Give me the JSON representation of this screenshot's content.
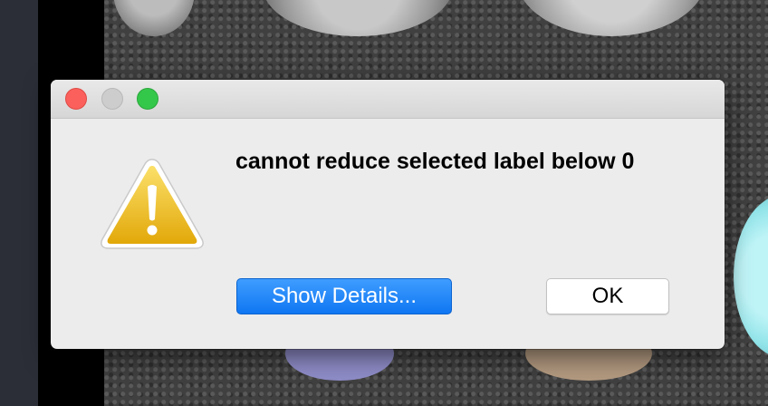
{
  "dialog": {
    "message": "cannot reduce selected label below 0",
    "buttons": {
      "details_label": "Show Details...",
      "ok_label": "OK"
    },
    "icon": "warning-triangle-icon"
  },
  "colors": {
    "accent": "#1a7ff5",
    "traffic_close": "#fc605c",
    "traffic_minimize": "#cdcdcd",
    "traffic_zoom": "#34c84a",
    "warning_yellow": "#f4c21f"
  }
}
